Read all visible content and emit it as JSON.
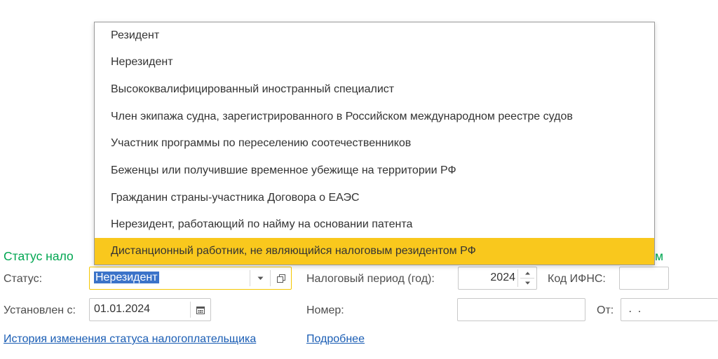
{
  "section": {
    "title_left": "Статус нало",
    "title_right": "м"
  },
  "form": {
    "status_label": "Статус:",
    "status_value": "Нерезидент",
    "established_label": "Установлен с:",
    "established_value": "01.01.2024",
    "tax_period_label": "Налоговый период (год):",
    "tax_period_value": "2024",
    "ifns_label": "Код ИФНС:",
    "ifns_value": "",
    "number_label": "Номер:",
    "number_value": "",
    "from_label": "От:",
    "from_value": " .  ."
  },
  "links": {
    "history": "История изменения статуса налогоплательщика",
    "details": "Подробнее"
  },
  "dropdown": {
    "items": [
      "Резидент",
      "Нерезидент",
      "Высококвалифицированный иностранный специалист",
      "Член экипажа судна, зарегистрированного в Российском международном реестре судов",
      "Участник программы по переселению соотечественников",
      "Беженцы или получившие временное убежище на территории РФ",
      "Гражданин страны-участника Договора о ЕАЭС",
      "Нерезидент, работающий по найму на основании патента",
      "Дистанционный работник, не являющийся налоговым резидентом РФ"
    ],
    "highlighted_color": "#F9C81D"
  },
  "icons": {
    "status_dropdown": "chevron-down-icon",
    "status_open": "open-window-icon",
    "calendar": "calendar-icon",
    "spin_up": "spin-up-icon",
    "spin_down": "spin-down-icon"
  }
}
